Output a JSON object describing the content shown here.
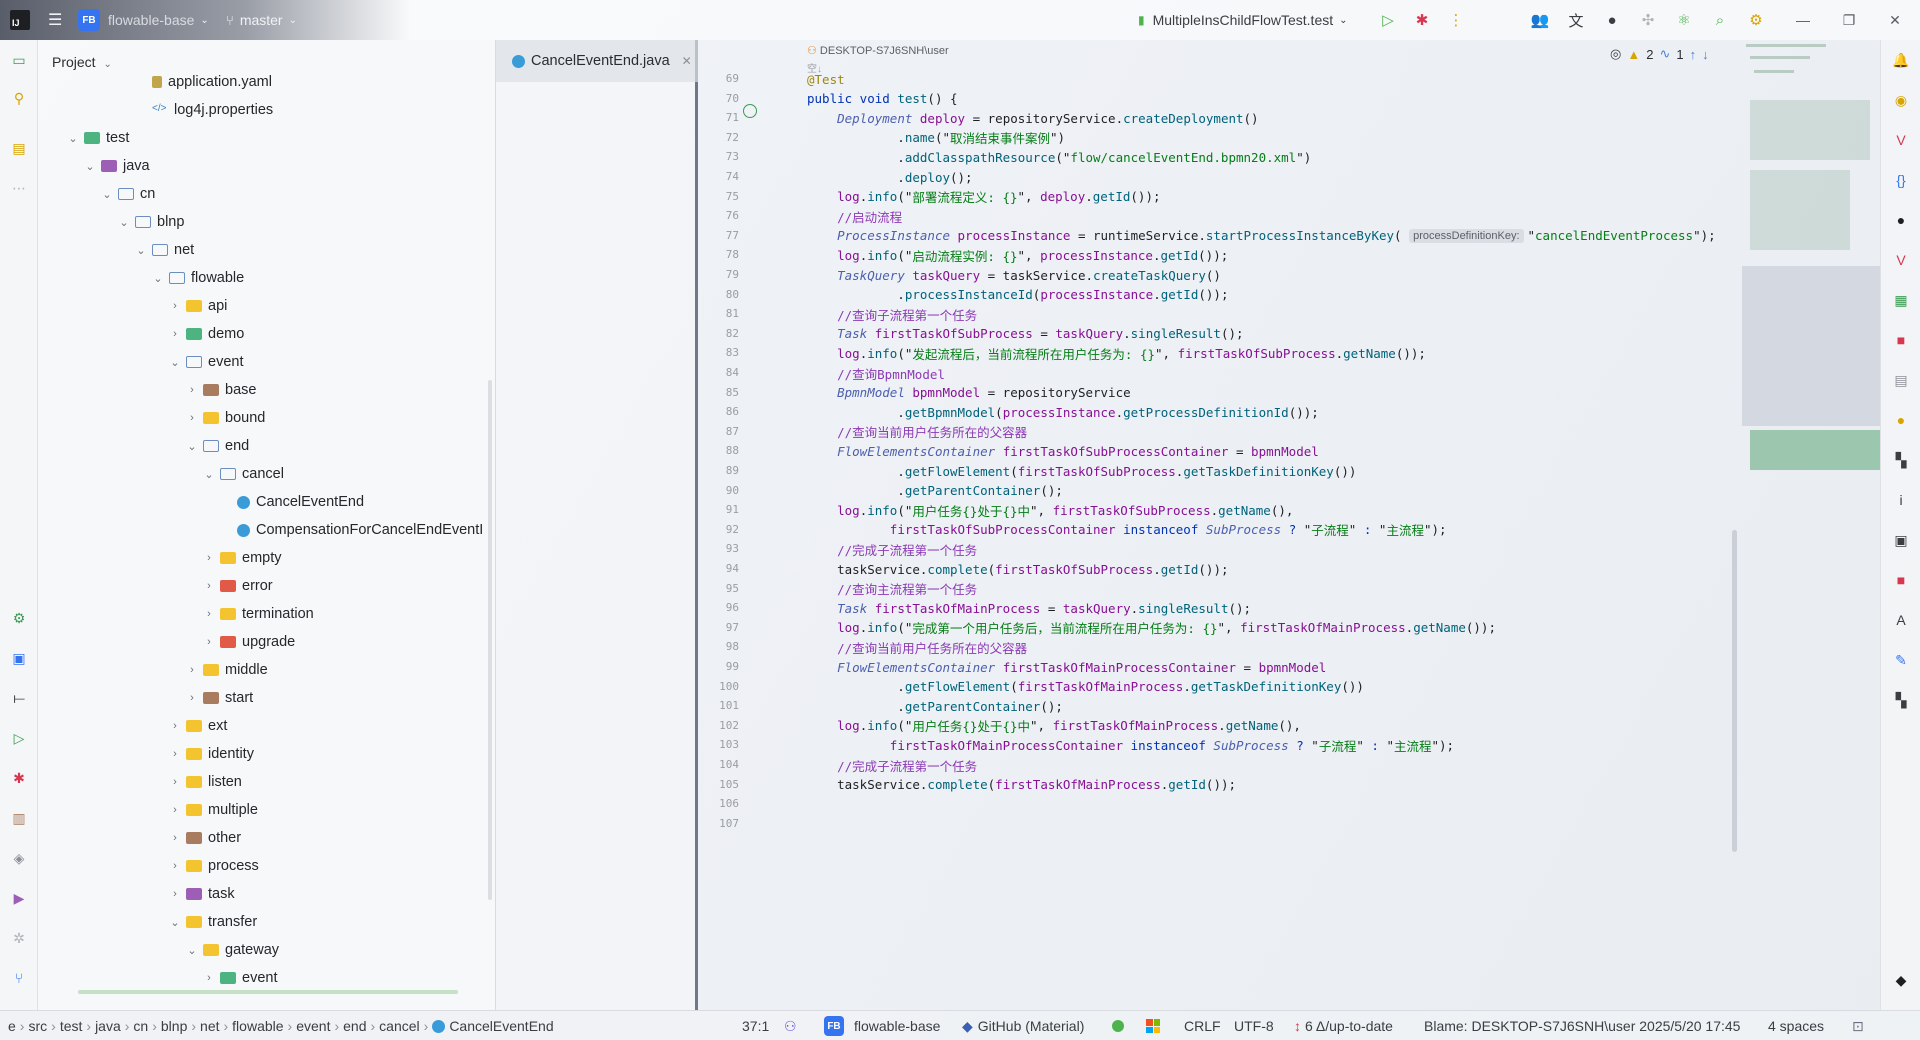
{
  "titlebar": {
    "project_badge": "FB",
    "project_name": "flowable-base",
    "branch": "master",
    "run_config": "MultipleInsChildFlowTest.test"
  },
  "project_panel": {
    "title": "Project",
    "tree": [
      {
        "label": "application.yaml",
        "depth": 6,
        "icon": "yaml-file",
        "chev": ""
      },
      {
        "label": "log4j.properties",
        "depth": 6,
        "icon": "xml-file",
        "chev": ""
      },
      {
        "label": "test",
        "depth": 2,
        "icon": "folder-green",
        "chev": "v"
      },
      {
        "label": "java",
        "depth": 3,
        "icon": "folder-purple",
        "chev": "v"
      },
      {
        "label": "cn",
        "depth": 4,
        "icon": "folder-outline",
        "chev": "v"
      },
      {
        "label": "blnp",
        "depth": 5,
        "icon": "folder-outline",
        "chev": "v"
      },
      {
        "label": "net",
        "depth": 6,
        "icon": "folder-outline",
        "chev": "v"
      },
      {
        "label": "flowable",
        "depth": 7,
        "icon": "folder-outline",
        "chev": "v"
      },
      {
        "label": "api",
        "depth": 8,
        "icon": "folder",
        "chev": ">"
      },
      {
        "label": "demo",
        "depth": 8,
        "icon": "folder-green",
        "chev": ">"
      },
      {
        "label": "event",
        "depth": 8,
        "icon": "folder-outline",
        "chev": "v"
      },
      {
        "label": "base",
        "depth": 9,
        "icon": "folder-brown",
        "chev": ">"
      },
      {
        "label": "bound",
        "depth": 9,
        "icon": "folder",
        "chev": ">"
      },
      {
        "label": "end",
        "depth": 9,
        "icon": "folder-outline",
        "chev": "v"
      },
      {
        "label": "cancel",
        "depth": 10,
        "icon": "folder-outline",
        "chev": "v"
      },
      {
        "label": "CancelEventEnd",
        "depth": 11,
        "icon": "java-file",
        "chev": ""
      },
      {
        "label": "CompensationForCancelEndEventI",
        "depth": 11,
        "icon": "java-file",
        "chev": ""
      },
      {
        "label": "empty",
        "depth": 10,
        "icon": "folder",
        "chev": ">"
      },
      {
        "label": "error",
        "depth": 10,
        "icon": "folder-red",
        "chev": ">"
      },
      {
        "label": "termination",
        "depth": 10,
        "icon": "folder",
        "chev": ">"
      },
      {
        "label": "upgrade",
        "depth": 10,
        "icon": "folder-red",
        "chev": ">"
      },
      {
        "label": "middle",
        "depth": 9,
        "icon": "folder",
        "chev": ">"
      },
      {
        "label": "start",
        "depth": 9,
        "icon": "folder-brown",
        "chev": ">"
      },
      {
        "label": "ext",
        "depth": 8,
        "icon": "folder",
        "chev": ">"
      },
      {
        "label": "identity",
        "depth": 8,
        "icon": "folder",
        "chev": ">"
      },
      {
        "label": "listen",
        "depth": 8,
        "icon": "folder",
        "chev": ">"
      },
      {
        "label": "multiple",
        "depth": 8,
        "icon": "folder",
        "chev": ">"
      },
      {
        "label": "other",
        "depth": 8,
        "icon": "folder-brown",
        "chev": ">"
      },
      {
        "label": "process",
        "depth": 8,
        "icon": "folder",
        "chev": ">"
      },
      {
        "label": "task",
        "depth": 8,
        "icon": "folder-purple",
        "chev": ">"
      },
      {
        "label": "transfer",
        "depth": 8,
        "icon": "folder",
        "chev": "v"
      },
      {
        "label": "gateway",
        "depth": 9,
        "icon": "folder",
        "chev": "v"
      },
      {
        "label": "event",
        "depth": 10,
        "icon": "folder-green",
        "chev": ">"
      }
    ]
  },
  "editor": {
    "tab_label": "CancelEventEnd.java",
    "author": "DESKTOP-S7J6SNH\\user",
    "author_sub": "空↓",
    "inspections": {
      "warnings": "2",
      "weak_warnings": "1"
    },
    "line_numbers": [
      "69",
      "70",
      "71",
      "72",
      "73",
      "74",
      "75",
      "76",
      "77",
      "78",
      "79",
      "80",
      "81",
      "82",
      "83",
      "84",
      "85",
      "86",
      "87",
      "88",
      "89",
      "90",
      "91",
      "92",
      "93",
      "94",
      "95",
      "96",
      "97",
      "98",
      "99",
      "100",
      "101",
      "102",
      "103",
      "104",
      "105",
      "106",
      "107"
    ],
    "lines": [
      [
        [
          "an",
          "@Test"
        ]
      ],
      [
        [
          "kw",
          "public void "
        ],
        [
          "fn",
          "test"
        ],
        [
          "",
          "() {"
        ]
      ],
      [
        [
          "",
          "    "
        ],
        [
          "ty",
          "Deployment "
        ],
        [
          "fld",
          "deploy"
        ],
        [
          "",
          " = repositoryService."
        ],
        [
          "fn",
          "createDeployment"
        ],
        [
          "",
          "()"
        ]
      ],
      [
        [
          "",
          "            ."
        ],
        [
          "fn",
          "name"
        ],
        [
          "",
          "(\""
        ],
        [
          "str",
          "取消结束事件案例"
        ],
        [
          "",
          "\")"
        ]
      ],
      [
        [
          "",
          "            ."
        ],
        [
          "fn",
          "addClasspathResource"
        ],
        [
          "",
          "(\""
        ],
        [
          "str",
          "flow/cancelEventEnd.bpmn20.xml"
        ],
        [
          "",
          "\")"
        ]
      ],
      [
        [
          "",
          "            ."
        ],
        [
          "fn",
          "deploy"
        ],
        [
          "",
          "();"
        ]
      ],
      [
        [
          "",
          "    "
        ],
        [
          "fld",
          "log"
        ],
        [
          "",
          "."
        ],
        [
          "fn",
          "info"
        ],
        [
          "",
          "(\""
        ],
        [
          "str",
          "部署流程定义: {}"
        ],
        [
          "",
          "\", "
        ],
        [
          "fld",
          "deploy"
        ],
        [
          "",
          "."
        ],
        [
          "fn",
          "getId"
        ],
        [
          "",
          "());"
        ]
      ],
      [
        [
          "",
          "    "
        ],
        [
          "cm",
          "//启动流程"
        ]
      ],
      [
        [
          "",
          "    "
        ],
        [
          "ty",
          "ProcessInstance "
        ],
        [
          "fld",
          "processInstance"
        ],
        [
          "",
          " = runtimeService."
        ],
        [
          "fn",
          "startProcessInstanceByKey"
        ],
        [
          "",
          "( "
        ],
        [
          "hint",
          "processDefinitionKey:"
        ],
        [
          "",
          "\""
        ],
        [
          "str",
          "cancelEndEventProcess"
        ],
        [
          "",
          "\");"
        ]
      ],
      [
        [
          "",
          "    "
        ],
        [
          "fld",
          "log"
        ],
        [
          "",
          "."
        ],
        [
          "fn",
          "info"
        ],
        [
          "",
          "(\""
        ],
        [
          "str",
          "启动流程实例: {}"
        ],
        [
          "",
          "\", "
        ],
        [
          "fld",
          "processInstance"
        ],
        [
          "",
          "."
        ],
        [
          "fn",
          "getId"
        ],
        [
          "",
          "());"
        ]
      ],
      [
        [
          "",
          "    "
        ],
        [
          "ty",
          "TaskQuery "
        ],
        [
          "fld",
          "taskQuery"
        ],
        [
          "",
          " = taskService."
        ],
        [
          "fn",
          "createTaskQuery"
        ],
        [
          "",
          "()"
        ]
      ],
      [
        [
          "",
          "            ."
        ],
        [
          "fn",
          "processInstanceId"
        ],
        [
          "",
          "("
        ],
        [
          "fld",
          "processInstance"
        ],
        [
          "",
          "."
        ],
        [
          "fn",
          "getId"
        ],
        [
          "",
          "());"
        ]
      ],
      [
        [
          "",
          "    "
        ],
        [
          "cm",
          "//查询子流程第一个任务"
        ]
      ],
      [
        [
          "",
          "    "
        ],
        [
          "ty",
          "Task "
        ],
        [
          "fld",
          "firstTaskOfSubProcess"
        ],
        [
          "",
          " = "
        ],
        [
          "fld",
          "taskQuery"
        ],
        [
          "",
          "."
        ],
        [
          "fn",
          "singleResult"
        ],
        [
          "",
          "();"
        ]
      ],
      [
        [
          "",
          "    "
        ],
        [
          "fld",
          "log"
        ],
        [
          "",
          "."
        ],
        [
          "fn",
          "info"
        ],
        [
          "",
          "(\""
        ],
        [
          "str",
          "发起流程后，当前流程所在用户任务为: {}"
        ],
        [
          "",
          "\", "
        ],
        [
          "fld",
          "firstTaskOfSubProcess"
        ],
        [
          "",
          "."
        ],
        [
          "fn",
          "getName"
        ],
        [
          "",
          "());"
        ]
      ],
      [
        [
          "",
          "    "
        ],
        [
          "cm",
          "//查询BpmnModel"
        ]
      ],
      [
        [
          "",
          "    "
        ],
        [
          "ty",
          "BpmnModel "
        ],
        [
          "fld",
          "bpmnModel"
        ],
        [
          "",
          " = repositoryService"
        ]
      ],
      [
        [
          "",
          "            ."
        ],
        [
          "fn",
          "getBpmnModel"
        ],
        [
          "",
          "("
        ],
        [
          "fld",
          "processInstance"
        ],
        [
          "",
          "."
        ],
        [
          "fn",
          "getProcessDefinitionId"
        ],
        [
          "",
          "());"
        ]
      ],
      [
        [
          "",
          "    "
        ],
        [
          "cm",
          "//查询当前用户任务所在的父容器"
        ]
      ],
      [
        [
          "",
          "    "
        ],
        [
          "ty",
          "FlowElementsContainer "
        ],
        [
          "fld",
          "firstTaskOfSubProcessContainer"
        ],
        [
          "",
          " = "
        ],
        [
          "fld",
          "bpmnModel"
        ]
      ],
      [
        [
          "",
          "            ."
        ],
        [
          "fn",
          "getFlowElement"
        ],
        [
          "",
          "("
        ],
        [
          "fld",
          "firstTaskOfSubProcess"
        ],
        [
          "",
          "."
        ],
        [
          "fn",
          "getTaskDefinitionKey"
        ],
        [
          "",
          "())"
        ]
      ],
      [
        [
          "",
          "            ."
        ],
        [
          "fn",
          "getParentContainer"
        ],
        [
          "",
          "();"
        ]
      ],
      [
        [
          "",
          "    "
        ],
        [
          "fld",
          "log"
        ],
        [
          "",
          "."
        ],
        [
          "fn",
          "info"
        ],
        [
          "",
          "(\""
        ],
        [
          "str",
          "用户任务{}处于{}中"
        ],
        [
          "",
          "\", "
        ],
        [
          "fld",
          "firstTaskOfSubProcess"
        ],
        [
          "",
          "."
        ],
        [
          "fn",
          "getName"
        ],
        [
          "",
          "(),"
        ]
      ],
      [
        [
          "",
          "           "
        ],
        [
          "fld",
          "firstTaskOfSubProcessContainer "
        ],
        [
          "kw",
          "instanceof "
        ],
        [
          "ty",
          "SubProcess "
        ],
        [
          "kw",
          "? "
        ],
        [
          "",
          "\""
        ],
        [
          "str",
          "子流程"
        ],
        [
          "",
          "\" "
        ],
        [
          "kw",
          ": "
        ],
        [
          "",
          "\""
        ],
        [
          "str",
          "主流程"
        ],
        [
          "",
          "\");"
        ]
      ],
      [
        [
          "",
          "    "
        ],
        [
          "cm",
          "//完成子流程第一个任务"
        ]
      ],
      [
        [
          "",
          "    taskService."
        ],
        [
          "fn",
          "complete"
        ],
        [
          "",
          "("
        ],
        [
          "fld",
          "firstTaskOfSubProcess"
        ],
        [
          "",
          "."
        ],
        [
          "fn",
          "getId"
        ],
        [
          "",
          "());"
        ]
      ],
      [
        [
          "",
          "    "
        ],
        [
          "cm",
          "//查询主流程第一个任务"
        ]
      ],
      [
        [
          "",
          "    "
        ],
        [
          "ty",
          "Task "
        ],
        [
          "fld",
          "firstTaskOfMainProcess"
        ],
        [
          "",
          " = "
        ],
        [
          "fld",
          "taskQuery"
        ],
        [
          "",
          "."
        ],
        [
          "fn",
          "singleResult"
        ],
        [
          "",
          "();"
        ]
      ],
      [
        [
          "",
          "    "
        ],
        [
          "fld",
          "log"
        ],
        [
          "",
          "."
        ],
        [
          "fn",
          "info"
        ],
        [
          "",
          "(\""
        ],
        [
          "str",
          "完成第一个用户任务后，当前流程所在用户任务为: {}"
        ],
        [
          "",
          "\", "
        ],
        [
          "fld",
          "firstTaskOfMainProcess"
        ],
        [
          "",
          "."
        ],
        [
          "fn",
          "getName"
        ],
        [
          "",
          "());"
        ]
      ],
      [
        [
          "",
          "    "
        ],
        [
          "cm",
          "//查询当前用户任务所在的父容器"
        ]
      ],
      [
        [
          "",
          "    "
        ],
        [
          "ty",
          "FlowElementsContainer "
        ],
        [
          "fld",
          "firstTaskOfMainProcessContainer"
        ],
        [
          "",
          " = "
        ],
        [
          "fld",
          "bpmnModel"
        ]
      ],
      [
        [
          "",
          "            ."
        ],
        [
          "fn",
          "getFlowElement"
        ],
        [
          "",
          "("
        ],
        [
          "fld",
          "firstTaskOfMainProcess"
        ],
        [
          "",
          "."
        ],
        [
          "fn",
          "getTaskDefinitionKey"
        ],
        [
          "",
          "())"
        ]
      ],
      [
        [
          "",
          "            ."
        ],
        [
          "fn",
          "getParentContainer"
        ],
        [
          "",
          "();"
        ]
      ],
      [
        [
          "",
          "    "
        ],
        [
          "fld",
          "log"
        ],
        [
          "",
          "."
        ],
        [
          "fn",
          "info"
        ],
        [
          "",
          "(\""
        ],
        [
          "str",
          "用户任务{}处于{}中"
        ],
        [
          "",
          "\", "
        ],
        [
          "fld",
          "firstTaskOfMainProcess"
        ],
        [
          "",
          "."
        ],
        [
          "fn",
          "getName"
        ],
        [
          "",
          "(),"
        ]
      ],
      [
        [
          "",
          "           "
        ],
        [
          "fld",
          "firstTaskOfMainProcessContainer "
        ],
        [
          "kw",
          "instanceof "
        ],
        [
          "ty",
          "SubProcess "
        ],
        [
          "kw",
          "? "
        ],
        [
          "",
          "\""
        ],
        [
          "str",
          "子流程"
        ],
        [
          "",
          "\" "
        ],
        [
          "kw",
          ": "
        ],
        [
          "",
          "\""
        ],
        [
          "str",
          "主流程"
        ],
        [
          "",
          "\");"
        ]
      ],
      [
        [
          "",
          "    "
        ],
        [
          "cm",
          "//完成子流程第一个任务"
        ]
      ],
      [
        [
          "",
          "    taskService."
        ],
        [
          "fn",
          "complete"
        ],
        [
          "",
          "("
        ],
        [
          "fld",
          "firstTaskOfMainProcess"
        ],
        [
          "",
          "."
        ],
        [
          "fn",
          "getId"
        ],
        [
          "",
          "());"
        ]
      ],
      [
        [
          "",
          ""
        ]
      ],
      [
        [
          "",
          ""
        ]
      ]
    ]
  },
  "statusbar": {
    "breadcrumb": [
      "e",
      "src",
      "test",
      "java",
      "cn",
      "blnp",
      "net",
      "flowable",
      "event",
      "end",
      "cancel",
      "CancelEventEnd"
    ],
    "position": "37:1",
    "project_badge": "FB",
    "project": "flowable-base",
    "theme": "GitHub (Material)",
    "line_sep": "CRLF",
    "encoding": "UTF-8",
    "vcs": "6 Δ/up-to-date",
    "blame": "Blame: DESKTOP-S7J6SNH\\user 2025/5/20 17:45",
    "indent": "4 spaces"
  },
  "colors": {
    "accent": "#3574f0",
    "keyword": "#0033b3",
    "string": "#067d17",
    "comment": "#8c3ab5"
  }
}
